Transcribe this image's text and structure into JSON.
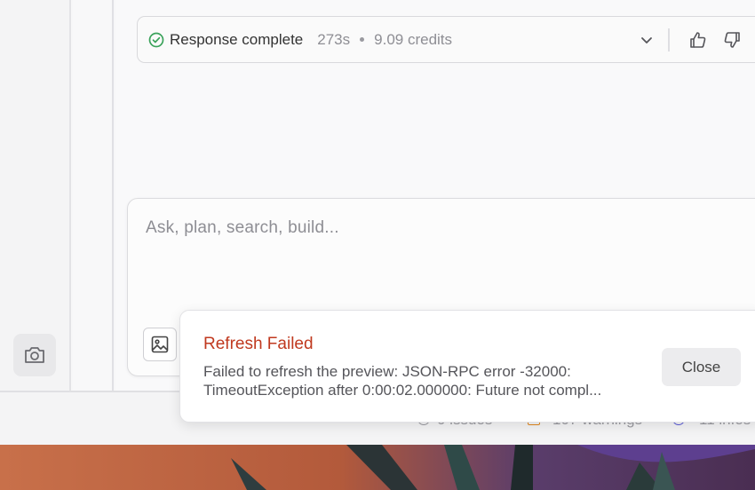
{
  "response": {
    "status": "Response complete",
    "duration": "273s",
    "credits": "9.09 credits"
  },
  "composer": {
    "placeholder": "Ask, plan, search, build..."
  },
  "status_bar": {
    "issues": "0 issues",
    "warnings": "107 warnings",
    "info": "11 infos"
  },
  "toast": {
    "title": "Refresh Failed",
    "message_line1": "Failed to refresh the preview: JSON-RPC error -32000:",
    "message_line2": "TimeoutException after 0:00:02.000000: Future not compl...",
    "close_label": "Close"
  },
  "colors": {
    "success": "#3aa25a",
    "error_title": "#c0391f",
    "warning": "#e2891f",
    "info": "#5b5bd6"
  },
  "icons": [
    "check-circle-icon",
    "chevron-down-icon",
    "thumbs-up-icon",
    "thumbs-down-icon",
    "camera-icon",
    "image-icon"
  ]
}
